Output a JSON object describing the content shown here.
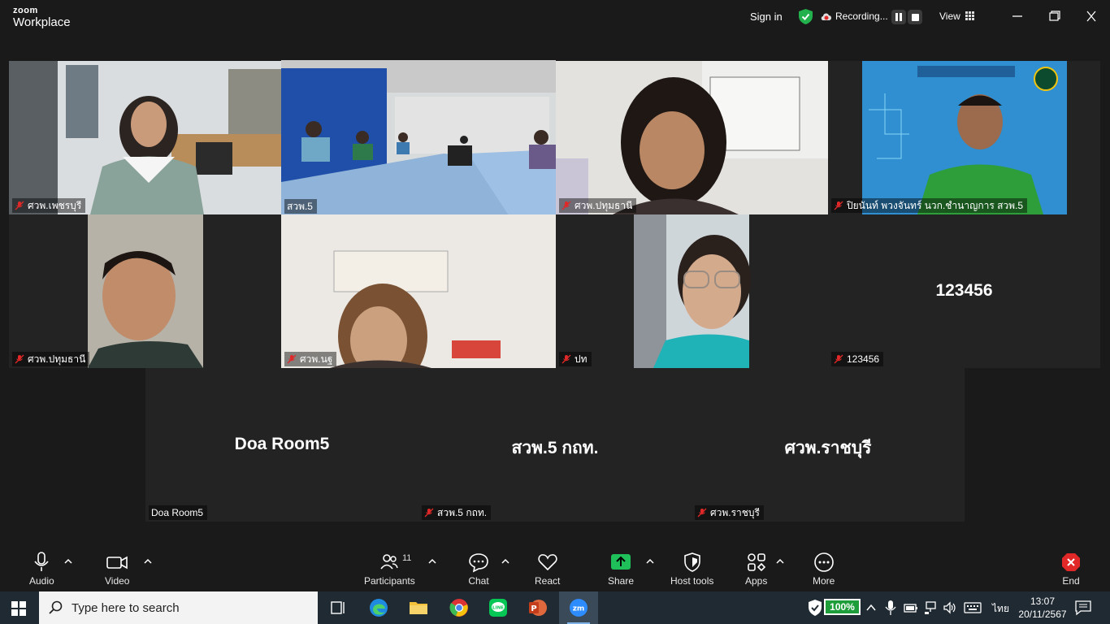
{
  "app": {
    "brand_top": "zoom",
    "brand_bottom": "Workplace",
    "sign_in": "Sign in",
    "recording": "Recording...",
    "view": "View"
  },
  "participants": [
    {
      "name": "ศวพ.เพชรบุรี"
    },
    {
      "name": "สวพ.5"
    },
    {
      "name": "ศวพ.ปทุมธานี"
    },
    {
      "name": "ปิยนันท์ พวงจันทร์ นวก.ชำนาญการ สวพ.5"
    },
    {
      "name": "ศวพ.ปทุมธานี"
    },
    {
      "name": "ศวพ.นฐ"
    },
    {
      "name": "ปท"
    },
    {
      "name": "123456",
      "big": "123456"
    },
    {
      "name": "Doa Room5",
      "big": "Doa Room5"
    },
    {
      "name": "สวพ.5 กถท.",
      "big": "สวพ.5 กถท."
    },
    {
      "name": "ศวพ.ราชบุรี",
      "big": "ศวพ.ราชบุรี"
    }
  ],
  "toolbar": {
    "audio": "Audio",
    "video": "Video",
    "participants": "Participants",
    "participant_count": "11",
    "chat": "Chat",
    "react": "React",
    "share": "Share",
    "host_tools": "Host tools",
    "apps": "Apps",
    "more": "More",
    "end": "End"
  },
  "taskbar": {
    "search_placeholder": "Type here to search",
    "battery": "100%",
    "language": "ไทย",
    "time": "13:07",
    "date": "20/11/2567"
  },
  "colors": {
    "active_speaker": "#36d17b",
    "end": "#e02828",
    "share": "#1fbf5a",
    "mute": "#e02828"
  }
}
